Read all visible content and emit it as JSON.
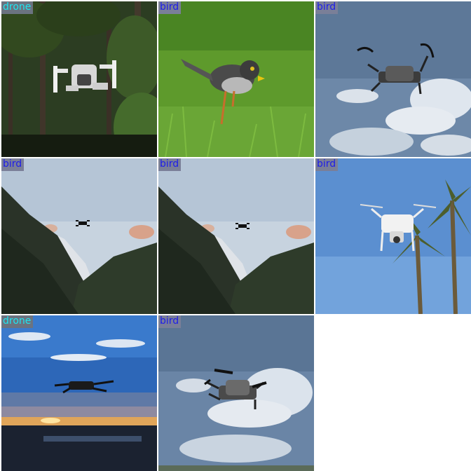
{
  "tiles": [
    {
      "label": "drone",
      "class": "drone",
      "scene": "forest"
    },
    {
      "label": "bird",
      "class": "bird",
      "scene": "grass"
    },
    {
      "label": "bird",
      "class": "bird",
      "scene": "sky-drone"
    },
    {
      "label": "bird",
      "class": "bird",
      "scene": "mountain"
    },
    {
      "label": "bird",
      "class": "bird",
      "scene": "mountain"
    },
    {
      "label": "bird",
      "class": "bird",
      "scene": "palm"
    },
    {
      "label": "drone",
      "class": "drone",
      "scene": "sunset"
    },
    {
      "label": "bird",
      "class": "bird",
      "scene": "sky-drone-2"
    }
  ],
  "colors": {
    "drone_label_bg": "#6b7380",
    "drone_label_text": "#1ee6f0",
    "bird_label_bg": "#7a7f98",
    "bird_label_text": "#1d1dea"
  }
}
